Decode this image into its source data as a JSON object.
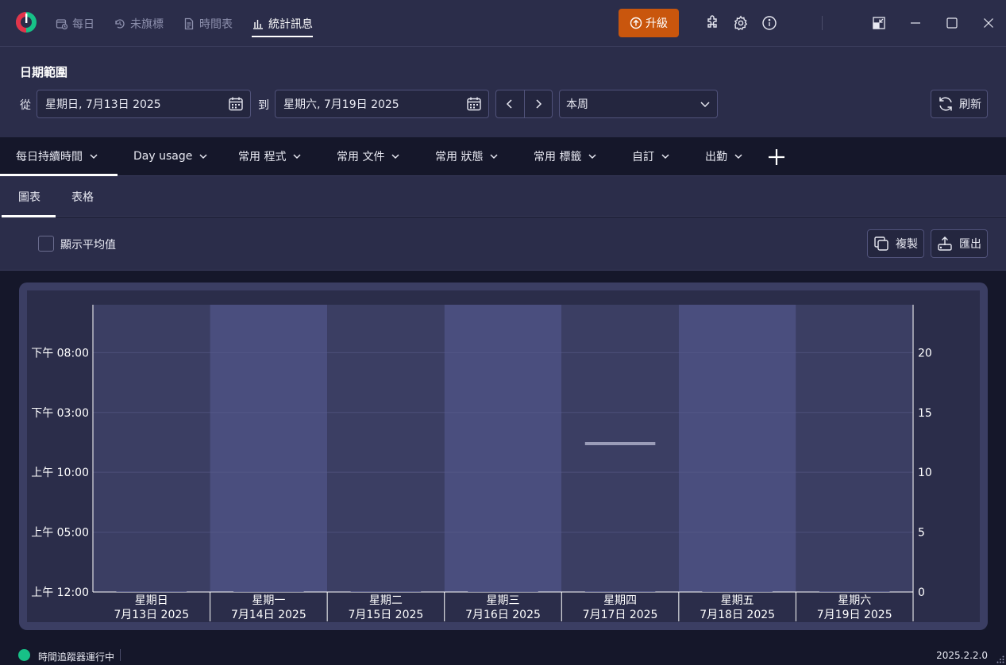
{
  "nav": {
    "items": [
      {
        "label": "每日",
        "icon": "calendar-clock-icon"
      },
      {
        "label": "未旗標",
        "icon": "untagged-icon"
      },
      {
        "label": "時間表",
        "icon": "document-icon"
      },
      {
        "label": "統計訊息",
        "icon": "bar-chart-icon"
      }
    ],
    "active": "統計訊息",
    "upgrade_label": "升級"
  },
  "date_range": {
    "title": "日期範圍",
    "from_label": "從",
    "from_value": "星期日, 7月13日 2025",
    "to_label": "到",
    "to_value": "星期六, 7月19日 2025",
    "preset_value": "本周",
    "refresh_label": "刷新"
  },
  "report_tabs": [
    {
      "label": "每日持續時間"
    },
    {
      "label": "Day usage"
    },
    {
      "label": "常用 程式"
    },
    {
      "label": "常用 文件"
    },
    {
      "label": "常用 狀態"
    },
    {
      "label": "常用 標籤"
    },
    {
      "label": "自訂"
    },
    {
      "label": "出勤"
    }
  ],
  "sub_tabs": [
    {
      "label": "圖表"
    },
    {
      "label": "表格"
    }
  ],
  "toolbar": {
    "show_average_label": "顯示平均值",
    "show_average_checked": false,
    "copy_label": "複製",
    "export_label": "匯出"
  },
  "chart_data": {
    "type": "bar",
    "categories": [
      [
        "星期日",
        "7月13日 2025"
      ],
      [
        "星期一",
        "7月14日 2025"
      ],
      [
        "星期二",
        "7月15日 2025"
      ],
      [
        "星期三",
        "7月16日 2025"
      ],
      [
        "星期四",
        "7月17日 2025"
      ],
      [
        "星期五",
        "7月18日 2025"
      ],
      [
        "星期六",
        "7月19日 2025"
      ]
    ],
    "y_left_ticks": [
      "上午 12:00",
      "上午 05:00",
      "上午 10:00",
      "下午 03:00",
      "下午 08:00"
    ],
    "y_right_ticks": [
      "0",
      "5",
      "10",
      "15",
      "20"
    ],
    "y_range": [
      0,
      24
    ],
    "marker": {
      "category_index": 4,
      "value": 12.4
    },
    "grid": true
  },
  "status": {
    "text": "時間追蹤器運行中",
    "version": "2025.2.2.0"
  },
  "colors": {
    "accent": "#c9560d",
    "status_green": "#17c187",
    "panel": "#2b2d4a",
    "chart_band_dark": "#3b3e63",
    "chart_band_light": "#4a4e7e"
  }
}
